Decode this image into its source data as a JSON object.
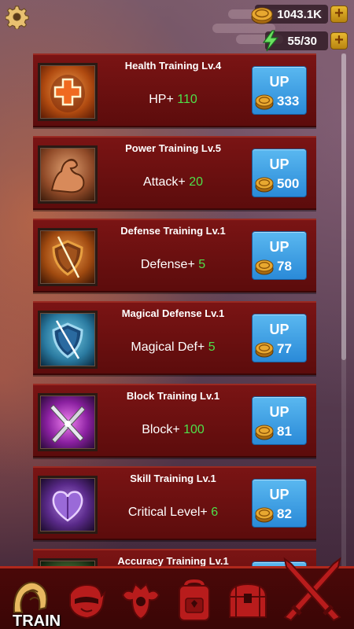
{
  "currency": {
    "gold": "1043.1K",
    "energy": "55/30"
  },
  "training": [
    {
      "title": "Health Training Lv.4",
      "stat_label": "HP+",
      "stat_value": "110",
      "button": "UP",
      "cost": "333",
      "icon": "health-cross-icon"
    },
    {
      "title": "Power Training Lv.5",
      "stat_label": "Attack+",
      "stat_value": "20",
      "button": "UP",
      "cost": "500",
      "icon": "flexed-arm-icon"
    },
    {
      "title": "Defense Training Lv.1",
      "stat_label": "Defense+",
      "stat_value": "5",
      "button": "UP",
      "cost": "78",
      "icon": "shield-orange-icon"
    },
    {
      "title": "Magical Defense Lv.1",
      "stat_label": "Magical Def+",
      "stat_value": "5",
      "button": "UP",
      "cost": "77",
      "icon": "shield-blue-icon"
    },
    {
      "title": "Block Training Lv.1",
      "stat_label": "Block+",
      "stat_value": "100",
      "button": "UP",
      "cost": "81",
      "icon": "crossed-blades-icon"
    },
    {
      "title": "Skill Training Lv.1",
      "stat_label": "Critical Level+",
      "stat_value": "6",
      "button": "UP",
      "cost": "82",
      "icon": "purple-heart-icon"
    },
    {
      "title": "Accuracy Training Lv.1",
      "stat_label": "",
      "stat_value": "",
      "button": "UP",
      "cost": "",
      "icon": "accuracy-icon"
    }
  ],
  "nav": {
    "active_label": "TRAIN",
    "items": [
      "train-icon",
      "ninja-icon",
      "samurai-icon",
      "backpack-icon",
      "chest-icon",
      "crossed-swords-icon"
    ]
  },
  "colors": {
    "card_bg": "#6a1010",
    "stat_value": "#4ee04a",
    "up_button": "#3a9ae0",
    "nav_bg": "#420808"
  }
}
